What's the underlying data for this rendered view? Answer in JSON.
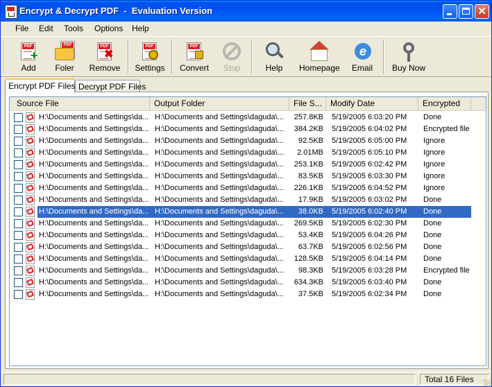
{
  "window": {
    "title": "Encrypt & Decrypt PDF  -  Evaluation Version"
  },
  "menu": [
    "File",
    "Edit",
    "Tools",
    "Options",
    "Help"
  ],
  "toolbar": {
    "add": "Add",
    "folder": "Foler",
    "remove": "Remove",
    "settings": "Settings",
    "convert": "Convert",
    "stop": "Stop",
    "help": "Help",
    "homepage": "Homepage",
    "email": "Email",
    "buy_now": "Buy Now"
  },
  "tabs": {
    "encrypt": "Encrypt  PDF Files",
    "decrypt": "Decrypt PDF Files"
  },
  "columns": {
    "source": "Source File",
    "output": "Output Folder",
    "size": "File S...",
    "date": "Modify Date",
    "encrypted": "Encrypted"
  },
  "rows": [
    {
      "source": "H:\\Documents and Settings\\da...",
      "output": "H:\\Documents and Settings\\daguda\\...",
      "size": "257.8KB",
      "date": "5/19/2005 6:03:20 PM",
      "status": "Done"
    },
    {
      "source": "H:\\Documents and Settings\\da...",
      "output": "H:\\Documents and Settings\\daguda\\...",
      "size": "384.2KB",
      "date": "5/19/2005 6:04:02 PM",
      "status": "Encrypted file"
    },
    {
      "source": "H:\\Documents and Settings\\da...",
      "output": "H:\\Documents and Settings\\daguda\\...",
      "size": "92.5KB",
      "date": "5/19/2005 6:05:00 PM",
      "status": "Ignore"
    },
    {
      "source": "H:\\Documents and Settings\\da...",
      "output": "H:\\Documents and Settings\\daguda\\...",
      "size": "2.01MB",
      "date": "5/19/2005 6:05:10 PM",
      "status": "Ignore"
    },
    {
      "source": "H:\\Documents and Settings\\da...",
      "output": "H:\\Documents and Settings\\daguda\\...",
      "size": "253.1KB",
      "date": "5/19/2005 6:02:42 PM",
      "status": "Ignore"
    },
    {
      "source": "H:\\Documents and Settings\\da...",
      "output": "H:\\Documents and Settings\\daguda\\...",
      "size": "83.5KB",
      "date": "5/19/2005 6:03:30 PM",
      "status": "Ignore"
    },
    {
      "source": "H:\\Documents and Settings\\da...",
      "output": "H:\\Documents and Settings\\daguda\\...",
      "size": "226.1KB",
      "date": "5/19/2005 6:04:52 PM",
      "status": "Ignore"
    },
    {
      "source": "H:\\Documents and Settings\\da...",
      "output": "H:\\Documents and Settings\\daguda\\...",
      "size": "17.9KB",
      "date": "5/19/2005 6:03:02 PM",
      "status": "Done"
    },
    {
      "source": "H:\\Documents and Settings\\da...",
      "output": "H:\\Documents and Settings\\daguda\\...",
      "size": "38.0KB",
      "date": "5/19/2005 6:02:40 PM",
      "status": "Done",
      "selected": true
    },
    {
      "source": "H:\\Documents and Settings\\da...",
      "output": "H:\\Documents and Settings\\daguda\\...",
      "size": "269.5KB",
      "date": "5/19/2005 6:02:30 PM",
      "status": "Done"
    },
    {
      "source": "H:\\Documents and Settings\\da...",
      "output": "H:\\Documents and Settings\\daguda\\...",
      "size": "53.4KB",
      "date": "5/19/2005 6:04:26 PM",
      "status": "Done"
    },
    {
      "source": "H:\\Documents and Settings\\da...",
      "output": "H:\\Documents and Settings\\daguda\\...",
      "size": "63.7KB",
      "date": "5/19/2005 6:02:56 PM",
      "status": "Done"
    },
    {
      "source": "H:\\Documents and Settings\\da...",
      "output": "H:\\Documents and Settings\\daguda\\...",
      "size": "128.5KB",
      "date": "5/19/2005 6:04:14 PM",
      "status": "Done"
    },
    {
      "source": "H:\\Documents and Settings\\da...",
      "output": "H:\\Documents and Settings\\daguda\\...",
      "size": "98.3KB",
      "date": "5/19/2005 6:03:28 PM",
      "status": "Encrypted file"
    },
    {
      "source": "H:\\Documents and Settings\\da...",
      "output": "H:\\Documents and Settings\\daguda\\...",
      "size": "634.3KB",
      "date": "5/19/2005 6:03:40 PM",
      "status": "Done"
    },
    {
      "source": "H:\\Documents and Settings\\da...",
      "output": "H:\\Documents and Settings\\daguda\\...",
      "size": "37.5KB",
      "date": "5/19/2005 6:02:34 PM",
      "status": "Done"
    }
  ],
  "status": {
    "total": "Total 16 Files"
  },
  "colors": {
    "titlebar": "#0054e3",
    "selection": "#316ac5",
    "face": "#ece9d8"
  }
}
